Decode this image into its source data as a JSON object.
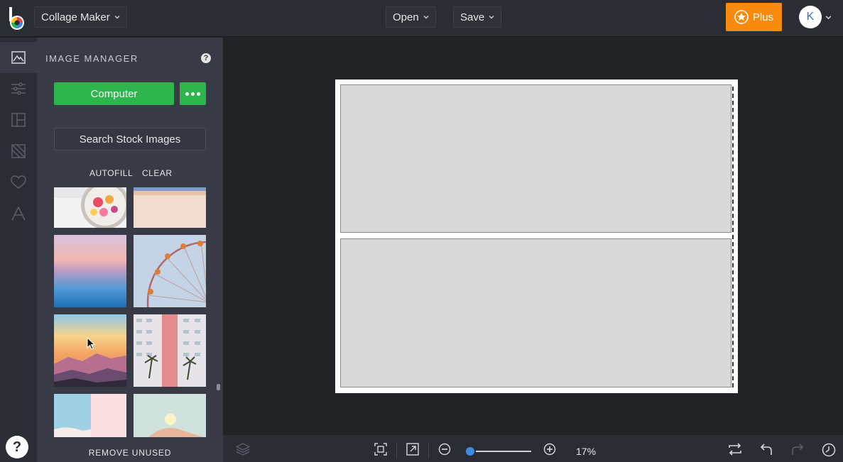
{
  "header": {
    "app_menu_label": "Collage Maker",
    "open_label": "Open",
    "save_label": "Save",
    "plus_label": "Plus",
    "avatar_initial": "K"
  },
  "sidebar": {
    "items": [
      {
        "icon": "image-icon",
        "active": true
      },
      {
        "icon": "sliders-icon",
        "active": false
      },
      {
        "icon": "layout-icon",
        "active": false
      },
      {
        "icon": "background-icon",
        "active": false
      },
      {
        "icon": "heart-icon",
        "active": false
      },
      {
        "icon": "text-icon",
        "active": false
      }
    ],
    "help_label": "?"
  },
  "panel": {
    "title": "IMAGE MANAGER",
    "help_label": "?",
    "computer_label": "Computer",
    "search_label": "Search Stock Images",
    "autofill_label": "AUTOFILL",
    "clear_label": "CLEAR",
    "remove_unused_label": "REMOVE UNUSED"
  },
  "canvas": {
    "cells": 2
  },
  "bottombar": {
    "zoom_value": "17%"
  },
  "colors": {
    "accent_green": "#2fb54d",
    "plus_orange": "#f88a0e",
    "zoom_blue": "#3d8be0"
  }
}
